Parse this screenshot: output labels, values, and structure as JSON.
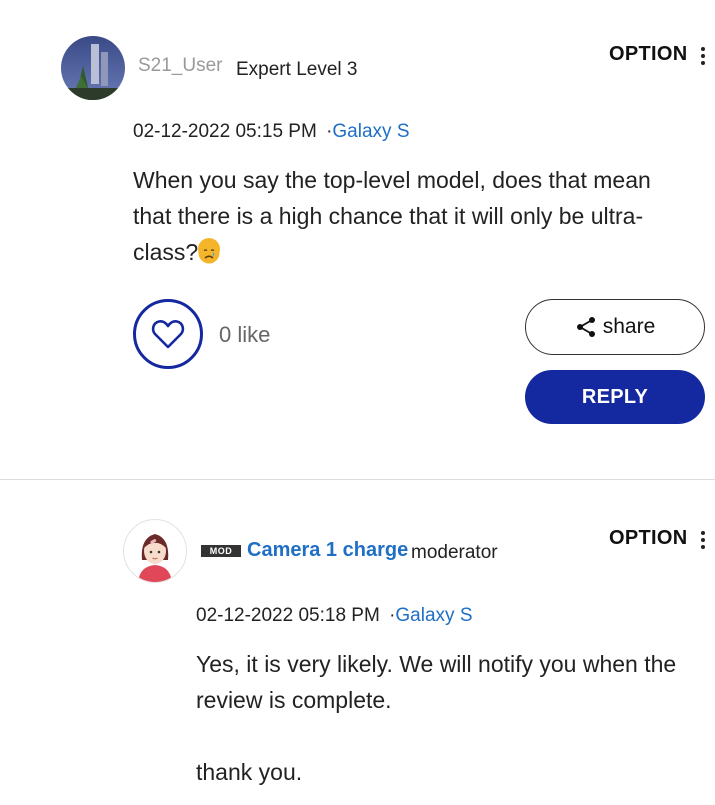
{
  "post1": {
    "username": "S21_User",
    "level": "Expert Level 3",
    "option_label": "OPTION",
    "date": "02-12-2022 05:15 PM",
    "category_sep": "·",
    "category": "Galaxy S",
    "body_line1": "When you say the top-level model, does that mean",
    "body_line2": "that there is a high chance that it will only be ultra-",
    "body_line3": "class?",
    "emoji": "crying-face-emoji",
    "like_count": "0 like",
    "share_label": "share",
    "reply_label": "REPLY"
  },
  "post2": {
    "badge": "MOD",
    "username": "Camera 1 charge",
    "role": "moderator",
    "option_label": "OPTION",
    "date": "02-12-2022 05:18 PM",
    "category_sep": "·",
    "category": "Galaxy S",
    "body_line1": "Yes, it is very likely. We will notify you when the",
    "body_line2": "review is complete.",
    "body_line3": "thank you."
  },
  "colors": {
    "accent": "#1428a0",
    "link": "#1f6fc5",
    "muted": "#9a9a9a"
  }
}
